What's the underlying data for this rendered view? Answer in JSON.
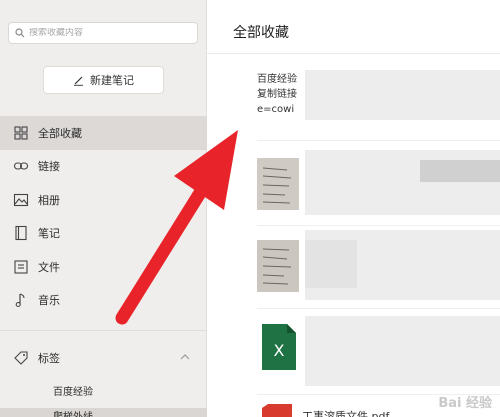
{
  "sidebar": {
    "search": {
      "placeholder": "搜索收藏内容"
    },
    "new_note_label": "新建笔记",
    "nav": [
      {
        "label": "全部收藏",
        "icon": "grid-icon",
        "active": true
      },
      {
        "label": "链接",
        "icon": "link-icon",
        "active": false
      },
      {
        "label": "相册",
        "icon": "image-icon",
        "active": false
      },
      {
        "label": "笔记",
        "icon": "note-icon",
        "active": false
      },
      {
        "label": "文件",
        "icon": "file-icon",
        "active": false
      },
      {
        "label": "音乐",
        "icon": "music-icon",
        "active": false
      }
    ],
    "tags": {
      "label": "标签",
      "items": [
        "百度经验",
        "爬梯外线"
      ]
    }
  },
  "main": {
    "title": "全部收藏",
    "items": [
      {
        "line1": "百度经验",
        "line2": "复制链接",
        "line3": "e=cowi"
      },
      {
        "type": "image"
      },
      {
        "type": "image"
      },
      {
        "type": "excel"
      },
      {
        "type": "pdf",
        "name": "工事溶质文件.pdf"
      }
    ]
  },
  "watermark": "Bai 经验",
  "colors": {
    "sidebar_bg": "#f0eeec",
    "active_bg": "#dcd9d6",
    "arrow_red": "#e8232a",
    "excel_green": "#1f7244",
    "pdf_red": "#d83b2e"
  }
}
